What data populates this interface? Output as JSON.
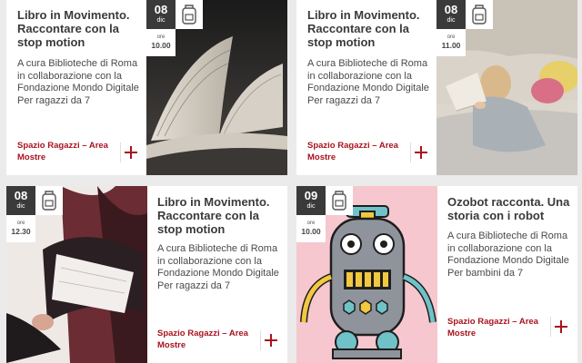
{
  "colors": {
    "accent": "#a8121f",
    "date_bg": "#3a3a3a",
    "page_bg": "#ebebeb"
  },
  "events": [
    {
      "day": "08",
      "month": "dic",
      "time_label": "ore",
      "time": "10.00",
      "icon": "backpack-icon",
      "title": "Libro in Movimento. Raccontare con la stop motion",
      "description": "A cura Biblioteche di Roma in collaborazione con la Fondazione Mondo Digitale Per ragazzi da 7",
      "location": "Spazio Ragazzi – Area Mostre",
      "image": "open-book-photo"
    },
    {
      "day": "08",
      "month": "dic",
      "time_label": "ore",
      "time": "11.00",
      "icon": "backpack-icon",
      "title": "Libro in Movimento. Raccontare con la stop motion",
      "description": "A cura Biblioteche di Roma in collaborazione con la Fondazione Mondo Digitale Per ragazzi da 7",
      "location": "Spazio Ragazzi – Area Mostre",
      "image": "child-reading-bed-photo"
    },
    {
      "day": "08",
      "month": "dic",
      "time_label": "ore",
      "time": "12.30",
      "icon": "backpack-icon",
      "title": "Libro in Movimento. Raccontare con la stop motion",
      "description": "A cura Biblioteche di Roma in collaborazione con la Fondazione Mondo Digitale Per ragazzi da 7",
      "location": "Spazio Ragazzi – Area Mostre",
      "image": "woman-reading-book-photo"
    },
    {
      "day": "09",
      "month": "dic",
      "time_label": "ore",
      "time": "10.00",
      "icon": "backpack-icon",
      "title": "Ozobot racconta. Una storia con i robot",
      "description": "A cura Biblioteche di Roma in collaborazione con la Fondazione Mondo Digitale Per bambini da 7",
      "location": "Spazio Ragazzi – Area Mostre",
      "image": "robot-illustration"
    }
  ]
}
